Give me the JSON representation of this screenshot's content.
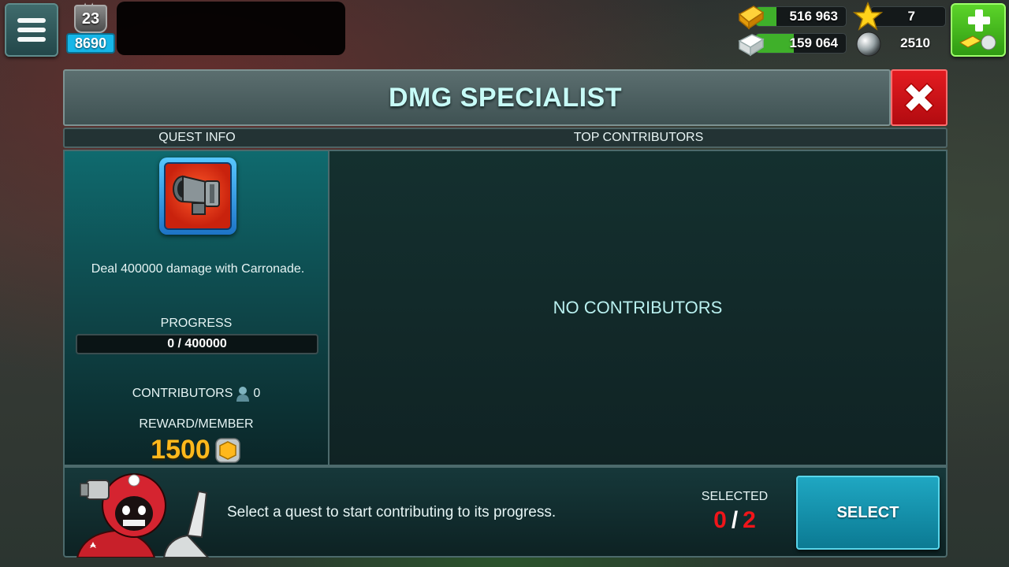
{
  "hud": {
    "level": "23",
    "xp": "8690",
    "gold": "516 963",
    "stone": "159 064",
    "stars": "7",
    "pearls": "2510"
  },
  "dialog": {
    "title": "DMG SPECIALIST",
    "tab_quest_info": "QUEST INFO",
    "tab_top_contributors": "TOP CONTRIBUTORS",
    "quest": {
      "description": "Deal 400000 damage with Carronade.",
      "progress_label": "PROGRESS",
      "progress_text": "0 / 400000",
      "progress_fraction": 0,
      "contributors_label": "CONTRIBUTORS",
      "contributors_count": "0",
      "reward_label": "REWARD/MEMBER",
      "reward_value": "1500"
    },
    "no_contributors": "NO CONTRIBUTORS",
    "footer": {
      "hint": "Select a quest to start contributing to its progress.",
      "selected_label": "SELECTED",
      "selected_current": "0",
      "selected_separator": "/",
      "selected_max": "2",
      "select_button": "SELECT"
    }
  },
  "colors": {
    "accent_teal": "#1fa7c2",
    "close_red": "#e31b20",
    "reward_gold": "#ffb81c",
    "selected_red": "#f0151a",
    "plus_green": "#5cd42a"
  }
}
